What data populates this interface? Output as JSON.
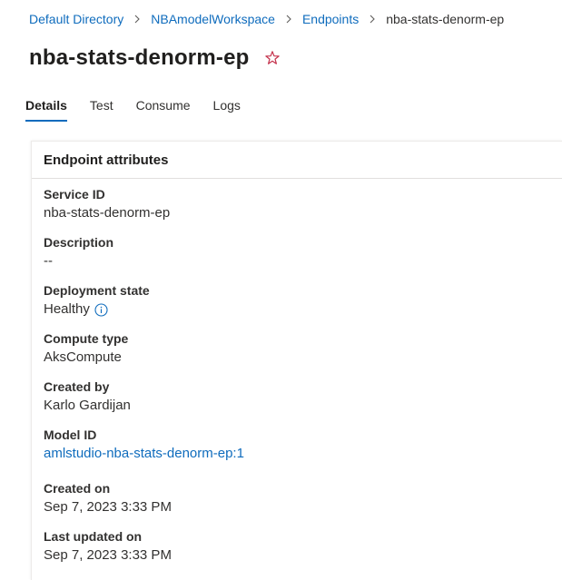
{
  "breadcrumb": {
    "items": [
      {
        "label": "Default Directory"
      },
      {
        "label": "NBAmodelWorkspace"
      },
      {
        "label": "Endpoints"
      },
      {
        "label": "nba-stats-denorm-ep"
      }
    ]
  },
  "header": {
    "title": "nba-stats-denorm-ep",
    "favorite_icon": "star-outline-icon"
  },
  "tabs": [
    {
      "label": "Details",
      "active": true
    },
    {
      "label": "Test",
      "active": false
    },
    {
      "label": "Consume",
      "active": false
    },
    {
      "label": "Logs",
      "active": false
    }
  ],
  "card": {
    "title": "Endpoint attributes",
    "attributes": {
      "service_id": {
        "label": "Service ID",
        "value": "nba-stats-denorm-ep"
      },
      "description": {
        "label": "Description",
        "value": "--"
      },
      "deployment_state": {
        "label": "Deployment state",
        "value": "Healthy",
        "icon": "info-icon"
      },
      "compute_type": {
        "label": "Compute type",
        "value": "AksCompute"
      },
      "created_by": {
        "label": "Created by",
        "value": "Karlo Gardijan"
      },
      "model_id": {
        "label": "Model ID",
        "value": "amlstudio-nba-stats-denorm-ep:1"
      },
      "created_on": {
        "label": "Created on",
        "value": "Sep 7, 2023 3:33 PM"
      },
      "last_updated_on": {
        "label": "Last updated on",
        "value": "Sep 7, 2023 3:33 PM"
      }
    }
  },
  "colors": {
    "link": "#0f6cbd",
    "star": "#c4314b",
    "text": "#323130"
  }
}
